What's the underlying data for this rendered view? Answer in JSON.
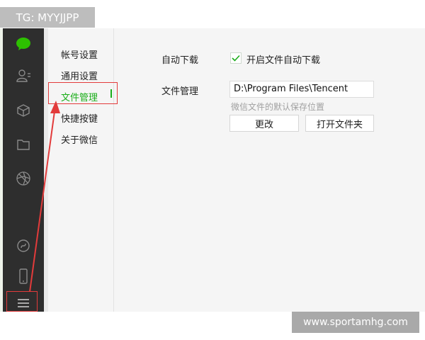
{
  "overlay": {
    "tg_label": "TG: MYYJJPP",
    "watermark": "www.sportamhg.com"
  },
  "sidebar_icons": [
    {
      "icon": "chat-icon",
      "color": "#2dc100"
    },
    {
      "icon": "contacts-icon"
    },
    {
      "icon": "cube-icon"
    },
    {
      "icon": "folder-icon"
    },
    {
      "icon": "moments-icon"
    },
    {
      "icon": "mini-program-icon"
    },
    {
      "icon": "phone-icon"
    },
    {
      "icon": "menu-icon"
    }
  ],
  "settings_nav": {
    "items": [
      {
        "label": "帐号设置"
      },
      {
        "label": "通用设置"
      },
      {
        "label": "文件管理",
        "active": true
      },
      {
        "label": "快捷按键"
      },
      {
        "label": "关于微信"
      }
    ]
  },
  "content": {
    "auto_download_label": "自动下载",
    "auto_download_option": "开启文件自动下载",
    "auto_download_checked": true,
    "file_mgmt_label": "文件管理",
    "path_value": "D:\\Program Files\\Tencent",
    "path_hint": "微信文件的默认保存位置",
    "change_button": "更改",
    "open_folder_button": "打开文件夹"
  },
  "colors": {
    "accent": "#1aad19",
    "highlight": "#e23b3b",
    "rail": "#2e2e2e"
  }
}
